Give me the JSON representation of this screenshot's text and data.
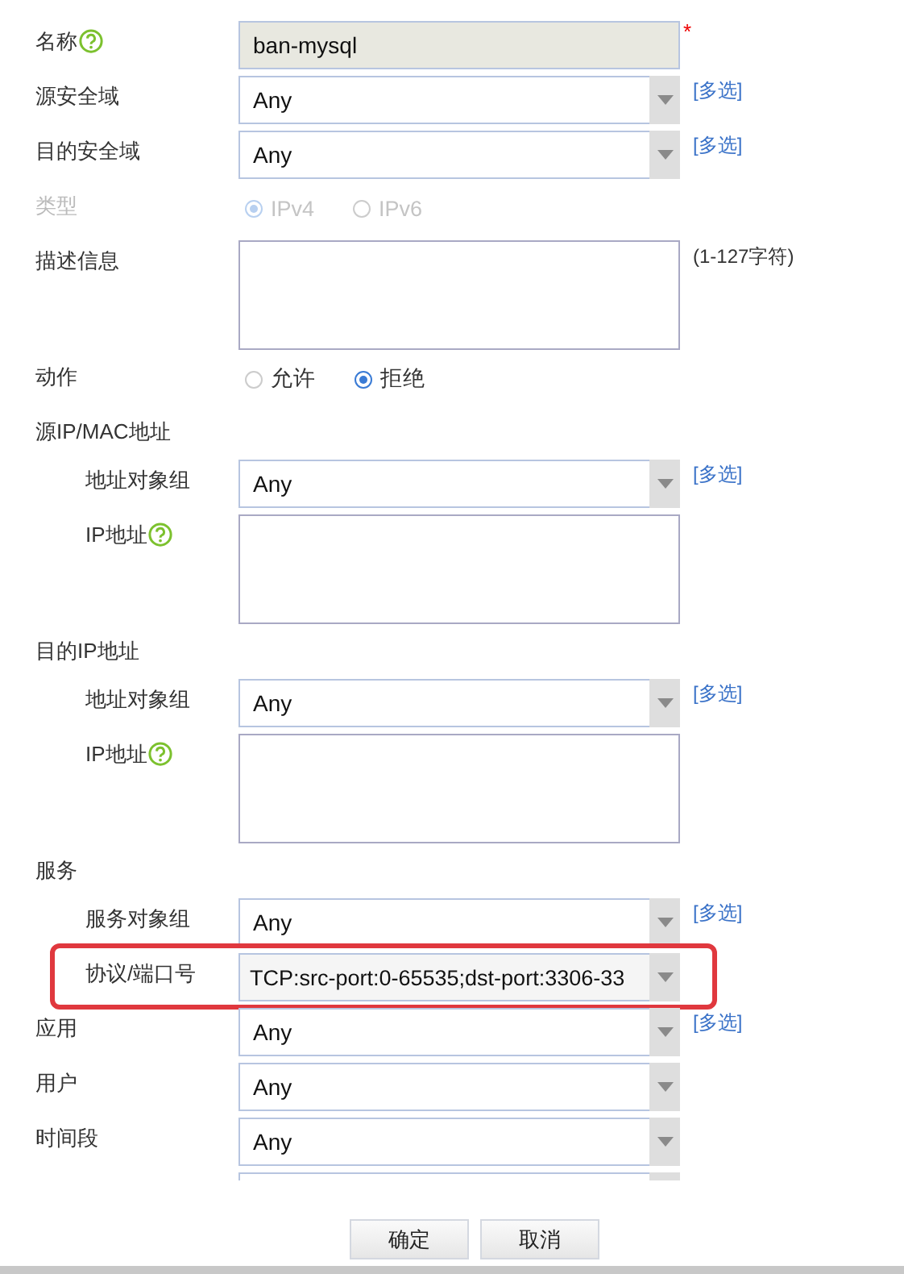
{
  "form": {
    "rows": [
      {
        "kind": "input",
        "label": "名称",
        "help": true,
        "value": "ban-mysql",
        "required": "*"
      },
      {
        "kind": "select",
        "label": "源安全域",
        "value": "Any",
        "link": "[多选]"
      },
      {
        "kind": "select",
        "label": "目的安全域",
        "value": "Any",
        "link": "[多选]"
      },
      {
        "kind": "radio",
        "label": "类型",
        "disabled": true,
        "options": [
          {
            "label": "IPv4",
            "selected": true
          },
          {
            "label": "IPv6",
            "selected": false
          }
        ]
      },
      {
        "kind": "textarea",
        "label": "描述信息",
        "hint": "(1-127字符)"
      },
      {
        "kind": "radio",
        "label": "动作",
        "disabled": false,
        "options": [
          {
            "label": "允许",
            "selected": false
          },
          {
            "label": "拒绝",
            "selected": true
          }
        ]
      },
      {
        "kind": "section",
        "label": "源IP/MAC地址",
        "children": [
          {
            "kind": "select",
            "label": "地址对象组",
            "value": "Any",
            "link": "[多选]"
          },
          {
            "kind": "textarea",
            "label": "IP地址",
            "help": true
          }
        ]
      },
      {
        "kind": "section",
        "label": "目的IP地址",
        "children": [
          {
            "kind": "select",
            "label": "地址对象组",
            "value": "Any",
            "link": "[多选]"
          },
          {
            "kind": "textarea",
            "label": "IP地址",
            "help": true
          }
        ]
      },
      {
        "kind": "section",
        "label": "服务",
        "children": [
          {
            "kind": "select",
            "label": "服务对象组",
            "value": "Any",
            "link": "[多选]"
          },
          {
            "kind": "select",
            "label": "协议/端口号",
            "value": "TCP:src-port:0-65535;dst-port:3306-33",
            "highlighted": true
          }
        ]
      },
      {
        "kind": "select",
        "label": "应用",
        "value": "Any",
        "link": "[多选]"
      },
      {
        "kind": "select",
        "label": "用户",
        "value": "Any"
      },
      {
        "kind": "select",
        "label": "时间段",
        "value": "Any"
      },
      {
        "kind": "clipped"
      }
    ]
  },
  "buttons": [
    "确定",
    "取消"
  ]
}
